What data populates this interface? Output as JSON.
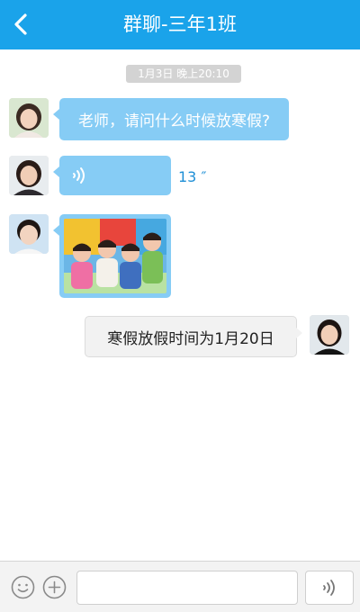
{
  "header": {
    "title": "群聊-三年1班",
    "back_icon": "chevron-left-icon"
  },
  "chat": {
    "timestamp": "1月3日  晚上20:10",
    "messages": [
      {
        "type": "text",
        "direction": "incoming",
        "text": "老师，请问什么时候放寒假?"
      },
      {
        "type": "voice",
        "direction": "incoming",
        "duration": "13 ″",
        "icon": "voice-wave-icon"
      },
      {
        "type": "image",
        "direction": "incoming",
        "description_icon": "photo-icon"
      },
      {
        "type": "text",
        "direction": "outgoing",
        "text": "寒假放假时间为1月20日"
      }
    ]
  },
  "footer": {
    "emoji_icon": "smiley-icon",
    "plus_icon": "plus-circle-icon",
    "input_value": "",
    "input_placeholder": "",
    "voice_icon": "voice-wave-icon"
  },
  "colors": {
    "header_bg": "#1aa3ea",
    "incoming_bubble": "#86ccf5",
    "outgoing_bubble": "#f2f2f2",
    "timestamp_bg": "#d3d3d3",
    "voice_duration": "#1e8fd6"
  }
}
